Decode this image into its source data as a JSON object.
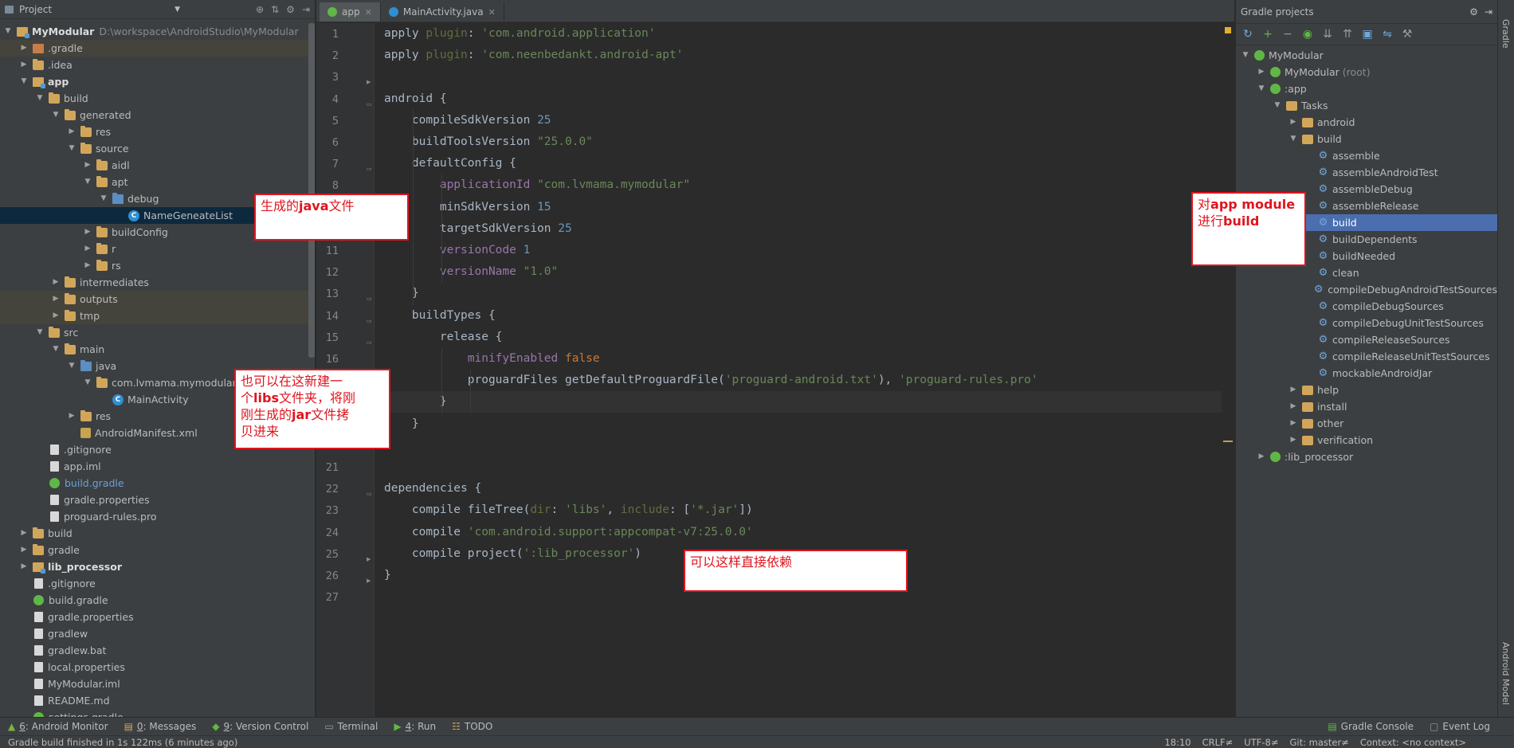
{
  "project_panel": {
    "title": "Project",
    "tree": [
      {
        "depth": 0,
        "arrow": "open",
        "icon": "folder-mod",
        "label": "MyModular",
        "bold": true,
        "path": "D:\\workspace\\AndroidStudio\\MyModular"
      },
      {
        "depth": 1,
        "arrow": "closed",
        "icon": "folder-ex",
        "label": ".gradle",
        "alt": true
      },
      {
        "depth": 1,
        "arrow": "closed",
        "icon": "folder",
        "label": ".idea"
      },
      {
        "depth": 1,
        "arrow": "open",
        "icon": "folder-mod",
        "label": "app",
        "bold": true
      },
      {
        "depth": 2,
        "arrow": "open",
        "icon": "folder",
        "label": "build"
      },
      {
        "depth": 3,
        "arrow": "open",
        "icon": "folder",
        "label": "generated"
      },
      {
        "depth": 4,
        "arrow": "closed",
        "icon": "folder",
        "label": "res"
      },
      {
        "depth": 4,
        "arrow": "open",
        "icon": "folder",
        "label": "source"
      },
      {
        "depth": 5,
        "arrow": "closed",
        "icon": "folder",
        "label": "aidl"
      },
      {
        "depth": 5,
        "arrow": "open",
        "icon": "folder",
        "label": "apt"
      },
      {
        "depth": 6,
        "arrow": "open",
        "icon": "folder-src",
        "label": "debug"
      },
      {
        "depth": 7,
        "arrow": "none",
        "icon": "classf",
        "label": "NameGeneateList",
        "selected": true
      },
      {
        "depth": 5,
        "arrow": "closed",
        "icon": "folder",
        "label": "buildConfig"
      },
      {
        "depth": 5,
        "arrow": "closed",
        "icon": "folder",
        "label": "r"
      },
      {
        "depth": 5,
        "arrow": "closed",
        "icon": "folder",
        "label": "rs"
      },
      {
        "depth": 3,
        "arrow": "closed",
        "icon": "folder",
        "label": "intermediates"
      },
      {
        "depth": 3,
        "arrow": "closed",
        "icon": "folder",
        "label": "outputs",
        "alt": true
      },
      {
        "depth": 3,
        "arrow": "closed",
        "icon": "folder",
        "label": "tmp",
        "alt": true
      },
      {
        "depth": 2,
        "arrow": "open",
        "icon": "folder",
        "label": "src"
      },
      {
        "depth": 3,
        "arrow": "open",
        "icon": "folder",
        "label": "main"
      },
      {
        "depth": 4,
        "arrow": "open",
        "icon": "folder-src",
        "label": "java"
      },
      {
        "depth": 5,
        "arrow": "open",
        "icon": "folder",
        "label": "com.lvmama.mymodular"
      },
      {
        "depth": 6,
        "arrow": "none",
        "icon": "classf",
        "label": "MainActivity"
      },
      {
        "depth": 4,
        "arrow": "closed",
        "icon": "folder",
        "label": "res"
      },
      {
        "depth": 4,
        "arrow": "none",
        "icon": "manifest",
        "label": "AndroidManifest.xml"
      },
      {
        "depth": 2,
        "arrow": "none",
        "icon": "file",
        "label": ".gitignore"
      },
      {
        "depth": 2,
        "arrow": "none",
        "icon": "file",
        "label": "app.iml"
      },
      {
        "depth": 2,
        "arrow": "none",
        "icon": "gradle",
        "label": "build.gradle",
        "link": true
      },
      {
        "depth": 2,
        "arrow": "none",
        "icon": "file",
        "label": "gradle.properties"
      },
      {
        "depth": 2,
        "arrow": "none",
        "icon": "file",
        "label": "proguard-rules.pro"
      },
      {
        "depth": 1,
        "arrow": "closed",
        "icon": "folder",
        "label": "build"
      },
      {
        "depth": 1,
        "arrow": "closed",
        "icon": "folder",
        "label": "gradle"
      },
      {
        "depth": 1,
        "arrow": "closed",
        "icon": "folder-mod",
        "label": "lib_processor",
        "bold": true
      },
      {
        "depth": 1,
        "arrow": "none",
        "icon": "file",
        "label": ".gitignore"
      },
      {
        "depth": 1,
        "arrow": "none",
        "icon": "gradle",
        "label": "build.gradle"
      },
      {
        "depth": 1,
        "arrow": "none",
        "icon": "file",
        "label": "gradle.properties"
      },
      {
        "depth": 1,
        "arrow": "none",
        "icon": "file",
        "label": "gradlew"
      },
      {
        "depth": 1,
        "arrow": "none",
        "icon": "file",
        "label": "gradlew.bat"
      },
      {
        "depth": 1,
        "arrow": "none",
        "icon": "file",
        "label": "local.properties"
      },
      {
        "depth": 1,
        "arrow": "none",
        "icon": "file",
        "label": "MyModular.iml"
      },
      {
        "depth": 1,
        "arrow": "none",
        "icon": "file",
        "label": "README.md"
      },
      {
        "depth": 1,
        "arrow": "none",
        "icon": "gradle",
        "label": "settings.gradle"
      }
    ]
  },
  "editor": {
    "tabs": [
      {
        "label": "app",
        "active": true,
        "icon_color": "#5fb846"
      },
      {
        "label": "MainActivity.java",
        "active": false,
        "icon_color": "#2f8fd1"
      }
    ],
    "current_line": 18,
    "lines": [
      {
        "n": "1",
        "parts": [
          [
            "fn",
            "apply "
          ],
          [
            "dim",
            "plugin"
          ],
          [
            "fn",
            ": "
          ],
          [
            "str",
            "'com.android.application'"
          ]
        ]
      },
      {
        "n": "2",
        "parts": [
          [
            "fn",
            "apply "
          ],
          [
            "dim",
            "plugin"
          ],
          [
            "fn",
            ": "
          ],
          [
            "str",
            "'com.neenbedankt.android-apt'"
          ]
        ]
      },
      {
        "n": "3",
        "parts": []
      },
      {
        "n": "4",
        "parts": [
          [
            "fn",
            "android {"
          ]
        ]
      },
      {
        "n": "5",
        "parts": [
          [
            "fn",
            "    compileSdkVersion "
          ],
          [
            "num",
            "25"
          ]
        ]
      },
      {
        "n": "6",
        "parts": [
          [
            "fn",
            "    buildToolsVersion "
          ],
          [
            "str",
            "\"25.0.0\""
          ]
        ]
      },
      {
        "n": "7",
        "parts": [
          [
            "fn",
            "    defaultConfig {"
          ]
        ]
      },
      {
        "n": "8",
        "parts": [
          [
            "prop",
            "        applicationId "
          ],
          [
            "str",
            "\"com.lvmama.mymodular\""
          ]
        ]
      },
      {
        "n": "9",
        "parts": [
          [
            "fn",
            "        minSdkVersion "
          ],
          [
            "num",
            "15"
          ]
        ]
      },
      {
        "n": "10",
        "parts": [
          [
            "fn",
            "        targetSdkVersion "
          ],
          [
            "num",
            "25"
          ]
        ]
      },
      {
        "n": "11",
        "parts": [
          [
            "prop",
            "        versionCode "
          ],
          [
            "num",
            "1"
          ]
        ]
      },
      {
        "n": "12",
        "parts": [
          [
            "prop",
            "        versionName "
          ],
          [
            "str",
            "\"1.0\""
          ]
        ]
      },
      {
        "n": "13",
        "parts": [
          [
            "fn",
            "    }"
          ]
        ]
      },
      {
        "n": "14",
        "parts": [
          [
            "fn",
            "    buildTypes {"
          ]
        ]
      },
      {
        "n": "15",
        "parts": [
          [
            "fn",
            "        release {"
          ]
        ]
      },
      {
        "n": "16",
        "parts": [
          [
            "prop",
            "            minifyEnabled "
          ],
          [
            "kw",
            "false"
          ]
        ]
      },
      {
        "n": "17",
        "parts": [
          [
            "fn",
            "            proguardFiles getDefaultProguardFile("
          ],
          [
            "str",
            "'proguard-android.txt'"
          ],
          [
            "fn",
            "), "
          ],
          [
            "str",
            "'proguard-rules.pro'"
          ]
        ]
      },
      {
        "n": "18",
        "parts": [
          [
            "fn",
            "        }"
          ]
        ]
      },
      {
        "n": "19",
        "parts": [
          [
            "fn",
            "    }"
          ]
        ]
      },
      {
        "n": "20",
        "parts": []
      },
      {
        "n": "21",
        "parts": []
      },
      {
        "n": "22",
        "parts": [
          [
            "fn",
            "dependencies {"
          ]
        ]
      },
      {
        "n": "23",
        "parts": [
          [
            "fn",
            "    compile fileTree("
          ],
          [
            "dim",
            "dir"
          ],
          [
            "fn",
            ": "
          ],
          [
            "str",
            "'libs'"
          ],
          [
            "fn",
            ", "
          ],
          [
            "dim",
            "include"
          ],
          [
            "fn",
            ": ["
          ],
          [
            "str",
            "'*.jar'"
          ],
          [
            "fn",
            "])"
          ]
        ]
      },
      {
        "n": "24",
        "parts": [
          [
            "fn",
            "    compile "
          ],
          [
            "str",
            "'com.android.support:appcompat-v7:25.0.0'"
          ]
        ]
      },
      {
        "n": "25",
        "parts": [
          [
            "fn",
            "    compile project("
          ],
          [
            "str",
            "':lib_processor'"
          ],
          [
            "fn",
            ")"
          ]
        ]
      },
      {
        "n": "26",
        "parts": [
          [
            "fn",
            "}"
          ]
        ]
      },
      {
        "n": "27",
        "parts": []
      }
    ],
    "visible_line_numbers": [
      "1",
      "2",
      "3",
      "4",
      "5",
      "6",
      "7",
      "8",
      "9",
      "10",
      "11",
      "12",
      "13",
      "14",
      "15",
      "16",
      "",
      "",
      "",
      "",
      "21",
      "22",
      "23",
      "24",
      "25",
      "26",
      "27"
    ]
  },
  "gradle_panel": {
    "title": "Gradle projects",
    "tree": [
      {
        "depth": 0,
        "arrow": "open",
        "icon": "gradle",
        "label": "MyModular"
      },
      {
        "depth": 1,
        "arrow": "closed",
        "icon": "gradle",
        "label": "MyModular",
        "muted": "(root)"
      },
      {
        "depth": 1,
        "arrow": "open",
        "icon": "gradle",
        "label": ":app"
      },
      {
        "depth": 2,
        "arrow": "open",
        "icon": "folder",
        "label": "Tasks"
      },
      {
        "depth": 3,
        "arrow": "closed",
        "icon": "folder",
        "label": "android"
      },
      {
        "depth": 3,
        "arrow": "open",
        "icon": "folder",
        "label": "build"
      },
      {
        "depth": 4,
        "arrow": "none",
        "icon": "gear",
        "label": "assemble"
      },
      {
        "depth": 4,
        "arrow": "none",
        "icon": "gear",
        "label": "assembleAndroidTest"
      },
      {
        "depth": 4,
        "arrow": "none",
        "icon": "gear",
        "label": "assembleDebug"
      },
      {
        "depth": 4,
        "arrow": "none",
        "icon": "gear",
        "label": "assembleRelease"
      },
      {
        "depth": 4,
        "arrow": "none",
        "icon": "gear",
        "label": "build",
        "selected": true
      },
      {
        "depth": 4,
        "arrow": "none",
        "icon": "gear",
        "label": "buildDependents"
      },
      {
        "depth": 4,
        "arrow": "none",
        "icon": "gear",
        "label": "buildNeeded"
      },
      {
        "depth": 4,
        "arrow": "none",
        "icon": "gear",
        "label": "clean"
      },
      {
        "depth": 4,
        "arrow": "none",
        "icon": "gear",
        "label": "compileDebugAndroidTestSources"
      },
      {
        "depth": 4,
        "arrow": "none",
        "icon": "gear",
        "label": "compileDebugSources"
      },
      {
        "depth": 4,
        "arrow": "none",
        "icon": "gear",
        "label": "compileDebugUnitTestSources"
      },
      {
        "depth": 4,
        "arrow": "none",
        "icon": "gear",
        "label": "compileReleaseSources"
      },
      {
        "depth": 4,
        "arrow": "none",
        "icon": "gear",
        "label": "compileReleaseUnitTestSources"
      },
      {
        "depth": 4,
        "arrow": "none",
        "icon": "gear",
        "label": "mockableAndroidJar"
      },
      {
        "depth": 3,
        "arrow": "closed",
        "icon": "folder",
        "label": "help"
      },
      {
        "depth": 3,
        "arrow": "closed",
        "icon": "folder",
        "label": "install"
      },
      {
        "depth": 3,
        "arrow": "closed",
        "icon": "folder",
        "label": "other"
      },
      {
        "depth": 3,
        "arrow": "closed",
        "icon": "folder",
        "label": "verification"
      },
      {
        "depth": 1,
        "arrow": "closed",
        "icon": "gradle",
        "label": ":lib_processor"
      }
    ]
  },
  "right_stripe": {
    "gradle": "Gradle",
    "android_model": "Android Model"
  },
  "bottom_tools": {
    "android_monitor_num": "6",
    "android_monitor": ": Android Monitor",
    "messages_num": "0",
    "messages": ": Messages",
    "version_control_num": "9",
    "version_control": ": Version Control",
    "terminal": "Terminal",
    "run_num": "4",
    "run": ": Run",
    "todo": "TODO",
    "gradle_console": "Gradle Console",
    "event_log": "Event Log"
  },
  "status_bar": {
    "message": "Gradle build finished in 1s 122ms (6 minutes ago)",
    "position": "18:10",
    "line_sep": "CRLF≠",
    "encoding": "UTF-8≠",
    "git": "Git: master≠",
    "context": "Context: <no context>"
  },
  "callouts": {
    "java_file": {
      "pre": "生成的",
      "bold": "java",
      "post": "文件"
    },
    "libs": {
      "line1": "也可以在这新建一",
      "line2_pre": "个",
      "line2_bold": "libs",
      "line2_post": "文件夹，将刚",
      "line3_pre": "刚生成的",
      "line3_bold": "jar",
      "line3_post": "文件拷",
      "line4": "贝进来"
    },
    "app_build": {
      "line1_pre": "对",
      "line1_bold": "app module",
      "line2_pre": "进行",
      "line2_bold": "build"
    },
    "depend": {
      "text": "可以这样直接依赖"
    }
  },
  "colors": {
    "accent_selection": "#4b6eaf",
    "callout_red": "#e0141e"
  }
}
